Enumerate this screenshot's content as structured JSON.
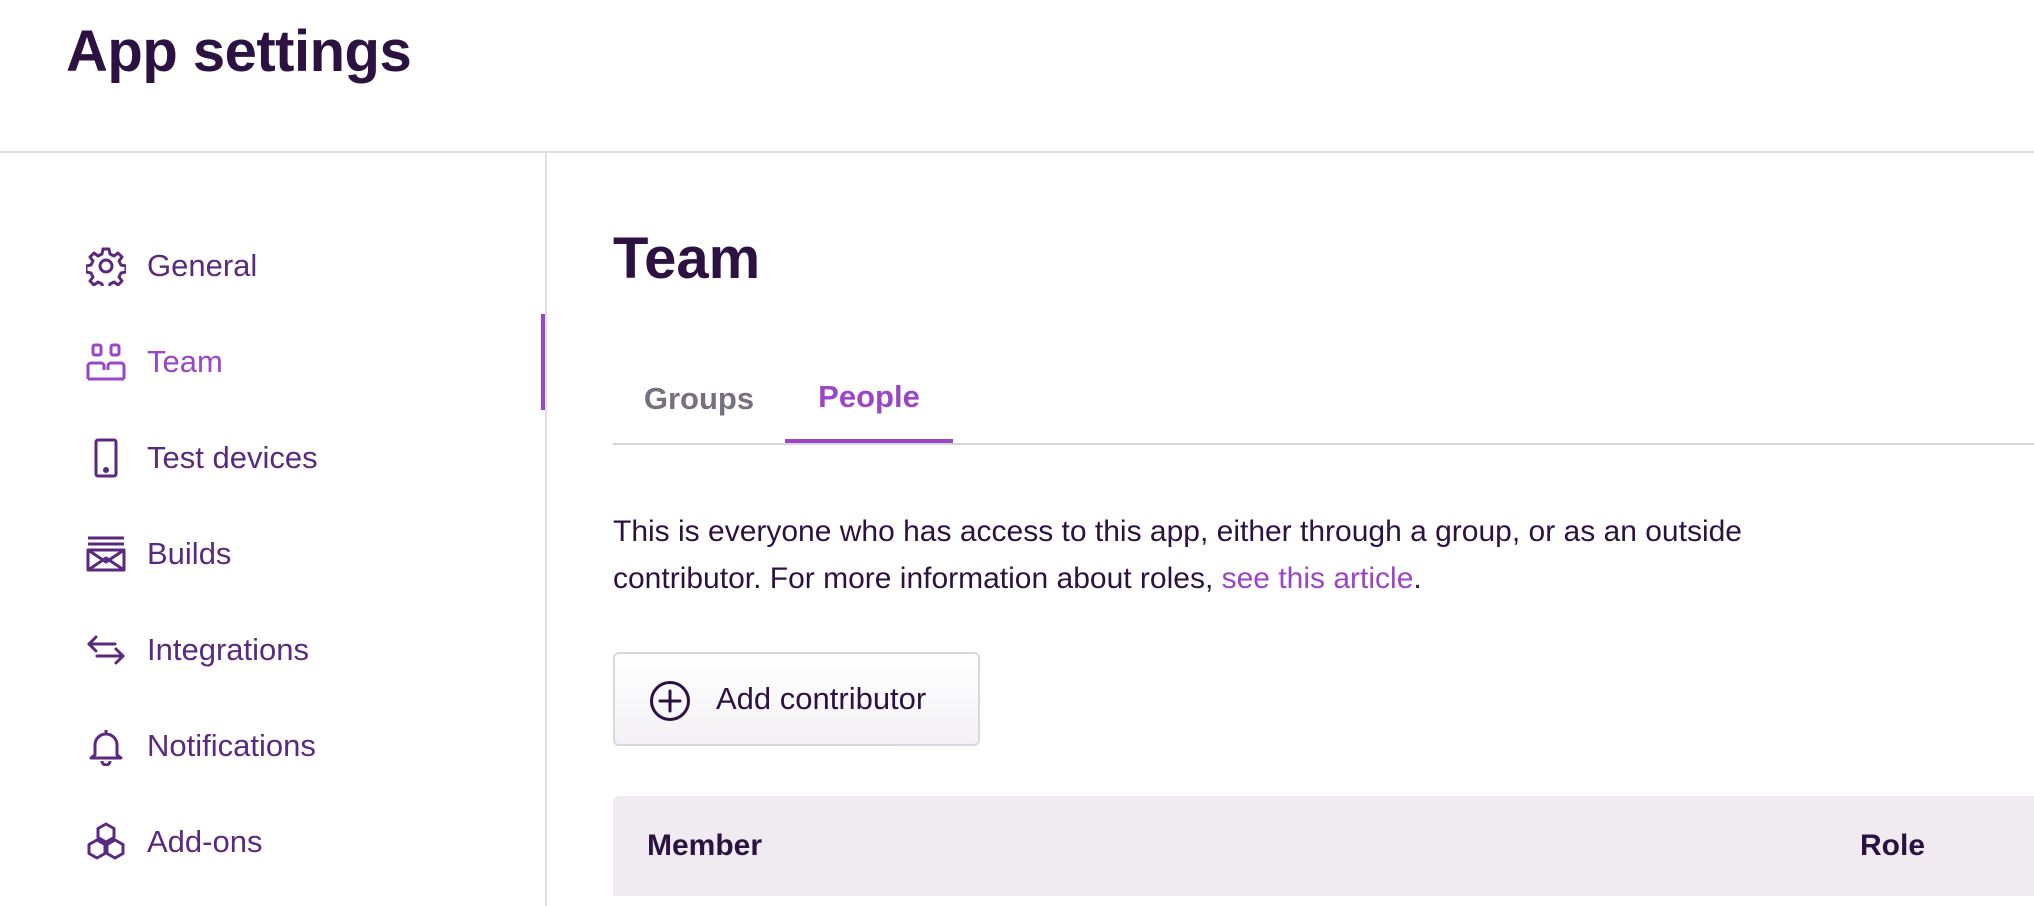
{
  "header": {
    "title": "App settings"
  },
  "sidebar": {
    "items": [
      {
        "label": "General",
        "icon": "gear-icon",
        "active": false
      },
      {
        "label": "Team",
        "icon": "team-icon",
        "active": true
      },
      {
        "label": "Test devices",
        "icon": "phone-icon",
        "active": false
      },
      {
        "label": "Builds",
        "icon": "builds-icon",
        "active": false
      },
      {
        "label": "Integrations",
        "icon": "arrows-icon",
        "active": false
      },
      {
        "label": "Notifications",
        "icon": "bell-icon",
        "active": false
      },
      {
        "label": "Add-ons",
        "icon": "addons-icon",
        "active": false
      }
    ]
  },
  "main": {
    "title": "Team",
    "tabs": [
      {
        "label": "Groups",
        "active": false
      },
      {
        "label": "People",
        "active": true
      }
    ],
    "description": {
      "text": "This is everyone who has access to this app, either through a group, or as an outside contributor. For more information about roles, ",
      "link": "see this article",
      "suffix": "."
    },
    "add_button": {
      "label": "Add contributor",
      "icon": "plus-circle-icon"
    },
    "table": {
      "columns": [
        "Member",
        "Role"
      ]
    }
  },
  "colors": {
    "text_dark": "#2b1240",
    "nav_text": "#5a2a7e",
    "accent": "#9b45c7",
    "tab_inactive": "#78707e",
    "table_header_bg": "#efebf0",
    "border": "#e2dde6"
  }
}
